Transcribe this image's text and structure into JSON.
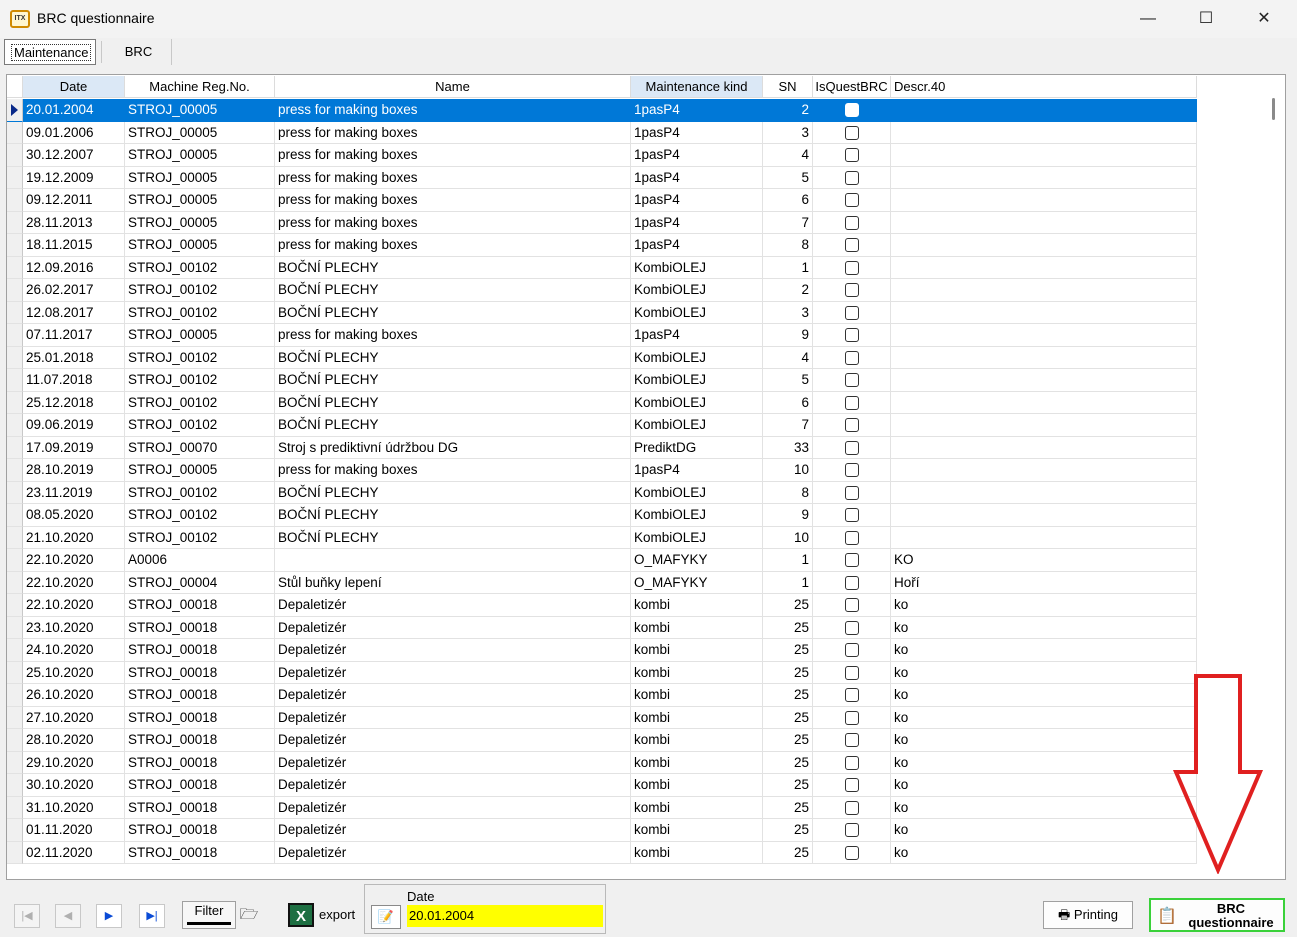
{
  "window": {
    "title": "BRC questionnaire",
    "minimize": "—",
    "maximize": "☐",
    "close": "✕"
  },
  "tabs": [
    {
      "label": "Maintenance",
      "active": true
    },
    {
      "label": "BRC",
      "active": false
    }
  ],
  "grid": {
    "columns": [
      "Date",
      "Machine Reg.No.",
      "Name",
      "Maintenance kind",
      "SN",
      "IsQuestBRC",
      "Descr.40"
    ],
    "rows": [
      [
        "20.01.2004",
        "STROJ_00005",
        "press for making boxes",
        "1pasP4",
        "2",
        ""
      ],
      [
        "09.01.2006",
        "STROJ_00005",
        "press for making boxes",
        "1pasP4",
        "3",
        ""
      ],
      [
        "30.12.2007",
        "STROJ_00005",
        "press for making boxes",
        "1pasP4",
        "4",
        ""
      ],
      [
        "19.12.2009",
        "STROJ_00005",
        "press for making boxes",
        "1pasP4",
        "5",
        ""
      ],
      [
        "09.12.2011",
        "STROJ_00005",
        "press for making boxes",
        "1pasP4",
        "6",
        ""
      ],
      [
        "28.11.2013",
        "STROJ_00005",
        "press for making boxes",
        "1pasP4",
        "7",
        ""
      ],
      [
        "18.11.2015",
        "STROJ_00005",
        "press for making boxes",
        "1pasP4",
        "8",
        ""
      ],
      [
        "12.09.2016",
        "STROJ_00102",
        "BOČNÍ PLECHY",
        "KombiOLEJ",
        "1",
        ""
      ],
      [
        "26.02.2017",
        "STROJ_00102",
        "BOČNÍ PLECHY",
        "KombiOLEJ",
        "2",
        ""
      ],
      [
        "12.08.2017",
        "STROJ_00102",
        "BOČNÍ PLECHY",
        "KombiOLEJ",
        "3",
        ""
      ],
      [
        "07.11.2017",
        "STROJ_00005",
        "press for making boxes",
        "1pasP4",
        "9",
        ""
      ],
      [
        "25.01.2018",
        "STROJ_00102",
        "BOČNÍ PLECHY",
        "KombiOLEJ",
        "4",
        ""
      ],
      [
        "11.07.2018",
        "STROJ_00102",
        "BOČNÍ PLECHY",
        "KombiOLEJ",
        "5",
        ""
      ],
      [
        "25.12.2018",
        "STROJ_00102",
        "BOČNÍ PLECHY",
        "KombiOLEJ",
        "6",
        ""
      ],
      [
        "09.06.2019",
        "STROJ_00102",
        "BOČNÍ PLECHY",
        "KombiOLEJ",
        "7",
        ""
      ],
      [
        "17.09.2019",
        "STROJ_00070",
        "Stroj s prediktivní údržbou DG",
        "PrediktDG",
        "33",
        ""
      ],
      [
        "28.10.2019",
        "STROJ_00005",
        "press for making boxes",
        "1pasP4",
        "10",
        ""
      ],
      [
        "23.11.2019",
        "STROJ_00102",
        "BOČNÍ PLECHY",
        "KombiOLEJ",
        "8",
        ""
      ],
      [
        "08.05.2020",
        "STROJ_00102",
        "BOČNÍ PLECHY",
        "KombiOLEJ",
        "9",
        ""
      ],
      [
        "21.10.2020",
        "STROJ_00102",
        "BOČNÍ PLECHY",
        "KombiOLEJ",
        "10",
        ""
      ],
      [
        "22.10.2020",
        "A0006",
        "",
        "O_MAFYKY",
        "1",
        "KO"
      ],
      [
        "22.10.2020",
        "STROJ_00004",
        "Stůl buňky lepení",
        "O_MAFYKY",
        "1",
        "Hoří"
      ],
      [
        "22.10.2020",
        "STROJ_00018",
        "Depaletizér",
        "kombi",
        "25",
        "ko"
      ],
      [
        "23.10.2020",
        "STROJ_00018",
        "Depaletizér",
        "kombi",
        "25",
        "ko"
      ],
      [
        "24.10.2020",
        "STROJ_00018",
        "Depaletizér",
        "kombi",
        "25",
        "ko"
      ],
      [
        "25.10.2020",
        "STROJ_00018",
        "Depaletizér",
        "kombi",
        "25",
        "ko"
      ],
      [
        "26.10.2020",
        "STROJ_00018",
        "Depaletizér",
        "kombi",
        "25",
        "ko"
      ],
      [
        "27.10.2020",
        "STROJ_00018",
        "Depaletizér",
        "kombi",
        "25",
        "ko"
      ],
      [
        "28.10.2020",
        "STROJ_00018",
        "Depaletizér",
        "kombi",
        "25",
        "ko"
      ],
      [
        "29.10.2020",
        "STROJ_00018",
        "Depaletizér",
        "kombi",
        "25",
        "ko"
      ],
      [
        "30.10.2020",
        "STROJ_00018",
        "Depaletizér",
        "kombi",
        "25",
        "ko"
      ],
      [
        "31.10.2020",
        "STROJ_00018",
        "Depaletizér",
        "kombi",
        "25",
        "ko"
      ],
      [
        "01.11.2020",
        "STROJ_00018",
        "Depaletizér",
        "kombi",
        "25",
        "ko"
      ],
      [
        "02.11.2020",
        "STROJ_00018",
        "Depaletizér",
        "kombi",
        "25",
        "ko"
      ]
    ],
    "selected_row": 0
  },
  "toolbar": {
    "nav_first": "|◀",
    "nav_prev": "◀",
    "nav_next": "▶",
    "nav_last": "▶|",
    "filter_label": "Filter",
    "export_label": "export",
    "date_label": "Date",
    "date_value": "20.01.2004",
    "printing_label": "Printing",
    "brc_button_label": "BRC questionnaire"
  },
  "colors": {
    "selection": "#0078d7",
    "date_highlight": "#ffff00",
    "brc_button_border": "#3ad13a",
    "annotation_arrow": "#e02020"
  }
}
